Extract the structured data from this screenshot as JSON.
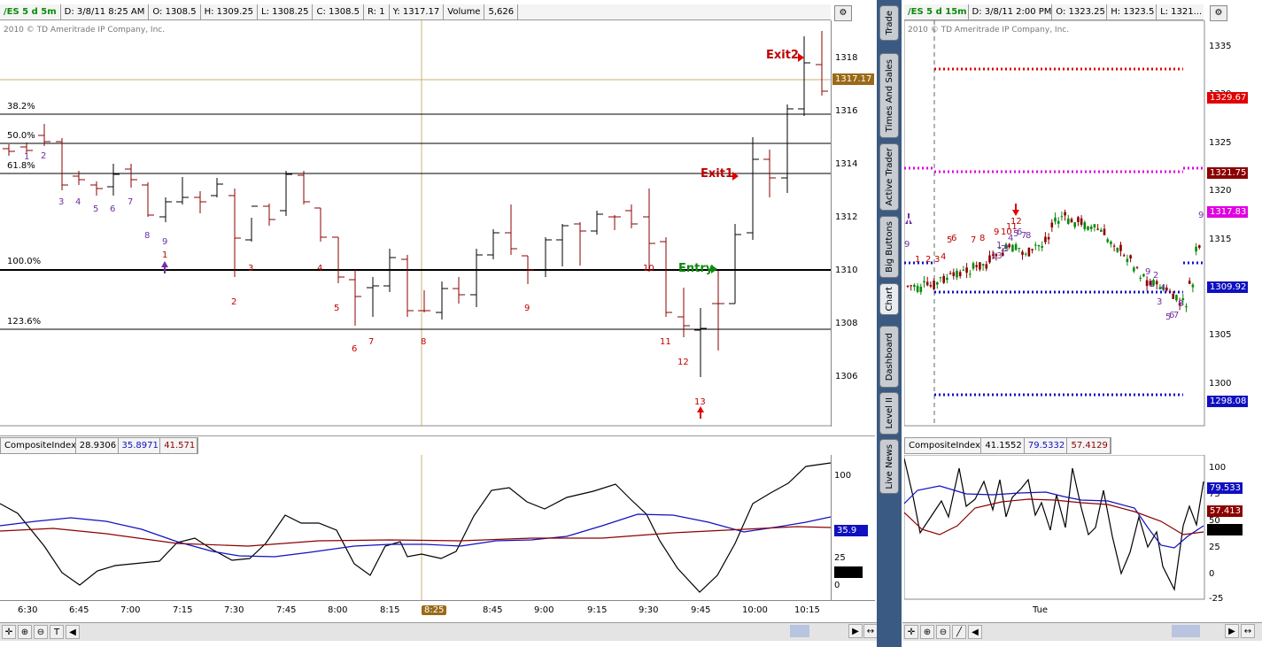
{
  "left_chart": {
    "symbol": "/ES 5 d 5m",
    "date": "D: 3/8/11 8:25 AM",
    "open": "O: 1308.5",
    "high": "H: 1309.25",
    "low": "L: 1308.25",
    "close": "C: 1308.5",
    "range": "R: 1",
    "y": "Y: 1317.17",
    "volume_label": "Volume",
    "volume": "5,626",
    "copyright": "2010 © TD Ameritrade IP Company, Inc.",
    "price_ticks": [
      "1318",
      "1316",
      "1314",
      "1312",
      "1310",
      "1308",
      "1306"
    ],
    "current_price": "1317.17",
    "fib_levels": [
      "38.2%",
      "50.0%",
      "61.8%",
      "100.0%",
      "123.6%"
    ],
    "labels": {
      "exit2": "Exit2",
      "exit1": "Exit1",
      "entry": "Entry"
    },
    "time_ticks": [
      "6:30",
      "6:45",
      "7:00",
      "7:15",
      "7:30",
      "7:45",
      "8:00",
      "8:15",
      "8:25",
      "8:45",
      "9:00",
      "9:15",
      "9:30",
      "9:45",
      "10:00",
      "10:15"
    ],
    "count_labels": [
      "1",
      "2",
      "3",
      "4",
      "5",
      "6",
      "7",
      "8",
      "9",
      "1",
      "2",
      "3",
      "4",
      "5",
      "6",
      "7",
      "8",
      "9",
      "10",
      "11",
      "12",
      "13"
    ]
  },
  "left_indicator": {
    "name": "CompositeIndex",
    "v1": "28.9306",
    "v2": "35.8971",
    "v3": "41.571",
    "ticks": [
      "100",
      "25",
      "0"
    ],
    "box_value": "35.9"
  },
  "right_chart": {
    "symbol": "/ES 5 d 15m",
    "date": "D: 3/8/11 2:00 PM",
    "open": "O: 1323.25",
    "high": "H: 1323.5",
    "low": "L: 1321...",
    "copyright": "2010 © TD Ameritrade IP Company, Inc.",
    "price_ticks": [
      "1335",
      "1330",
      "1325",
      "1320",
      "1315",
      "1310",
      "1305",
      "1300"
    ],
    "price_boxes": {
      "red": "1329.67",
      "darkred": "1321.75",
      "magenta": "1317.83",
      "blue1": "1309.92",
      "blue2": "1298.08"
    },
    "time_tick": "Tue",
    "count_labels": [
      "9",
      "1",
      "2",
      "3",
      "4",
      "5",
      "6",
      "7",
      "8",
      "9",
      "10",
      "11",
      "12",
      "13",
      "1",
      "2",
      "3",
      "4",
      "5",
      "6",
      "7",
      "8",
      "9",
      "1",
      "2",
      "3",
      "4",
      "5",
      "6",
      "7",
      "8",
      "9",
      "2",
      "1"
    ]
  },
  "right_indicator": {
    "name": "CompositeIndex",
    "v1": "41.1552",
    "v2": "79.5332",
    "v3": "57.4129",
    "ticks": [
      "100",
      "75",
      "50",
      "25",
      "0",
      "-25"
    ],
    "box1": "79.533",
    "box2": "57.413"
  },
  "side_tabs": [
    "Trade",
    "Times And Sales",
    "Active Trader",
    "Big Buttons",
    "Chart",
    "Dashboard",
    "Level II",
    "Live News"
  ],
  "colors": {
    "up": "#000000",
    "down": "#8b0000",
    "fib": "#000000",
    "red": "#e00000",
    "magenta": "#e000e0",
    "blue": "#1010c0",
    "sidebar": "#3a5a84"
  }
}
